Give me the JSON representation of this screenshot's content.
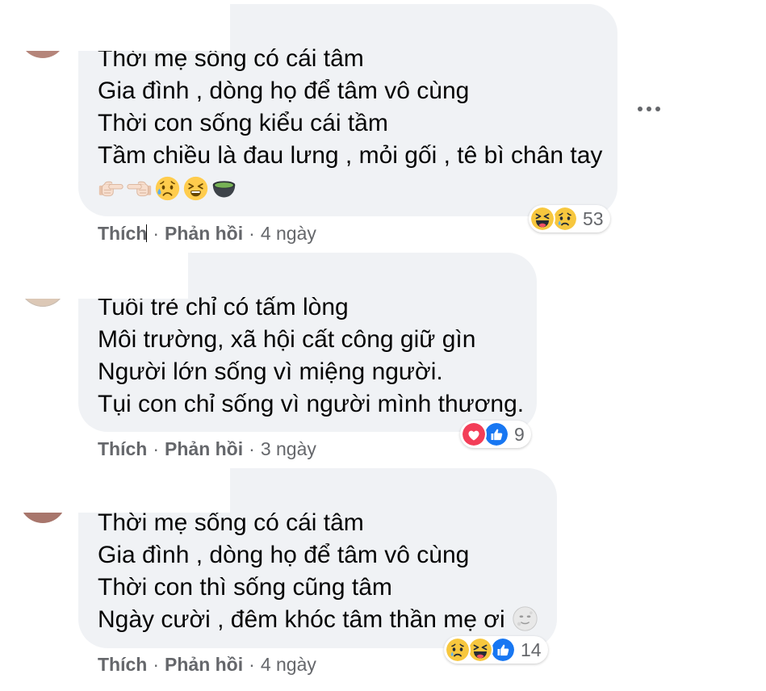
{
  "separator": "·",
  "comments": [
    {
      "lines": [
        "Thời mẹ sống có cái tâm",
        "Gia đình , dòng họ để tâm vô cùng",
        "Thời con sống kiểu cái tầm",
        "Tầm chiều là đau lưng , mỏi gối , tê bì chân tay"
      ],
      "emoji_row": [
        "backhand-index-pointing-right-icon",
        "backhand-index-pointing-left-icon",
        "sad-but-relieved-face-icon",
        "tired-face-icon",
        "teacup-icon"
      ],
      "reactions": {
        "icons": [
          "haha-reaction-icon",
          "sad-reaction-icon"
        ],
        "count": "53"
      },
      "actions": {
        "like": "Thích",
        "reply": "Phản hồi",
        "time": "4 ngày"
      },
      "menu_icon": "more-options-icon"
    },
    {
      "lines": [
        "Tuổi trẻ chỉ có tấm lòng",
        "Môi trường, xã hội cất công giữ gìn",
        "Người lớn sống vì miệng người.",
        "Tụi con chỉ sống vì người mình thương."
      ],
      "reactions": {
        "icons": [
          "love-reaction-icon",
          "like-reaction-icon"
        ],
        "count": "9"
      },
      "actions": {
        "like": "Thích",
        "reply": "Phản hồi",
        "time": "3 ngày"
      }
    },
    {
      "lines": [
        "Thời mẹ sống có cái tâm",
        "Gia đình , dòng họ để tâm vô cùng",
        "Thời con thì sống cũng tâm",
        "Ngày cười , đêm khóc tâm thần mẹ ơi"
      ],
      "line_end_emoji": "full-moon-face-icon",
      "reactions": {
        "icons": [
          "sad-reaction-icon",
          "haha-reaction-icon",
          "like-reaction-icon"
        ],
        "count": "14"
      },
      "actions": {
        "like": "Thích",
        "reply": "Phản hồi",
        "time": "4 ngày"
      }
    }
  ],
  "colors": {
    "bubble_background": "#f0f2f5",
    "text": "#050505",
    "secondary_text": "#65676b",
    "like_blue": "#1877f2",
    "love_red": "#f33e58",
    "reaction_yellow": "#f7c73e"
  }
}
